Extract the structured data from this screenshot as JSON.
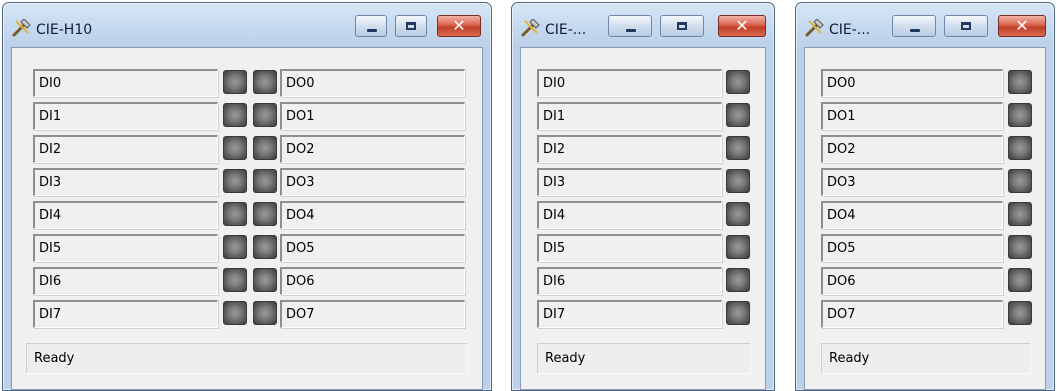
{
  "windows": [
    {
      "title": "CIE-H10",
      "status": "Ready",
      "di": [
        "DI0",
        "DI1",
        "DI2",
        "DI3",
        "DI4",
        "DI5",
        "DI6",
        "DI7"
      ],
      "do": [
        "DO0",
        "DO1",
        "DO2",
        "DO3",
        "DO4",
        "DO5",
        "DO6",
        "DO7"
      ]
    },
    {
      "title": "CIE-...",
      "status": "Ready",
      "di": [
        "DI0",
        "DI1",
        "DI2",
        "DI3",
        "DI4",
        "DI5",
        "DI6",
        "DI7"
      ]
    },
    {
      "title": "CIE-...",
      "status": "Ready",
      "do": [
        "DO0",
        "DO1",
        "DO2",
        "DO3",
        "DO4",
        "DO5",
        "DO6",
        "DO7"
      ]
    }
  ],
  "led_state": "off",
  "icons": {
    "app": "tools-icon",
    "minimize": "minimize-icon",
    "maximize": "maximize-icon",
    "close": "close-icon"
  },
  "colors": {
    "close_button": "#c9452e",
    "led_off": "#6f6f6f"
  }
}
